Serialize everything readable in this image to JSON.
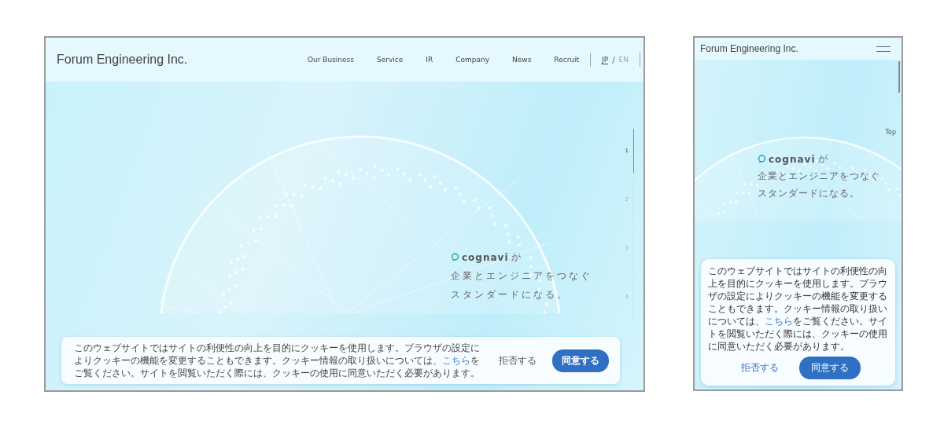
{
  "desktop": {
    "logo": "Forum Engineering Inc.",
    "nav": [
      {
        "label": "Our Business"
      },
      {
        "label": "Service"
      },
      {
        "label": "IR"
      },
      {
        "label": "Company"
      },
      {
        "label": "News"
      },
      {
        "label": "Recruit"
      }
    ],
    "languages": [
      {
        "label": "JP",
        "selected": true
      },
      {
        "label": "EN",
        "selected": false
      }
    ],
    "language_separator": "/",
    "slides": [
      {
        "label": "1",
        "selected": true
      },
      {
        "label": "2",
        "selected": false
      },
      {
        "label": "3",
        "selected": false
      },
      {
        "label": "4",
        "selected": false
      }
    ],
    "tagline": {
      "brand": "cognavi",
      "particle": "が",
      "lines": [
        "企業とエンジニアをつなぐ",
        "スタンダードになる。"
      ]
    },
    "cookie": {
      "text_before": "このウェブサイトではサイトの利便性の向上を目的にクッキーを使用します。ブラウザの設定によりクッキーの機能を変更することもできます。クッキー情報の取り扱いについては、",
      "link": "こちら",
      "text_after": "をご覧ください。サイトを閲覧いただく際には、クッキーの使用に同意いただく必要があります。",
      "reject": "拒否する",
      "accept": "同意する"
    }
  },
  "mobile": {
    "logo": "Forum Engineering Inc.",
    "top_label": "Top",
    "tagline": {
      "brand": "cognavi",
      "particle": "が",
      "lines": [
        "企業とエンジニアをつなぐ",
        "スタンダードになる。"
      ]
    },
    "cookie": {
      "text_before": "このウェブサイトではサイトの利便性の向上を目的にクッキーを使用します。ブラウザの設定によりクッキーの機能を変更することもできます。クッキー情報の取り扱いについては、",
      "link": "こちら",
      "text_after": "をご覧ください。サイトを閲覧いただく際には、クッキーの使用に同意いただく必要があります。",
      "reject": "拒否する",
      "accept": "同意する"
    }
  }
}
